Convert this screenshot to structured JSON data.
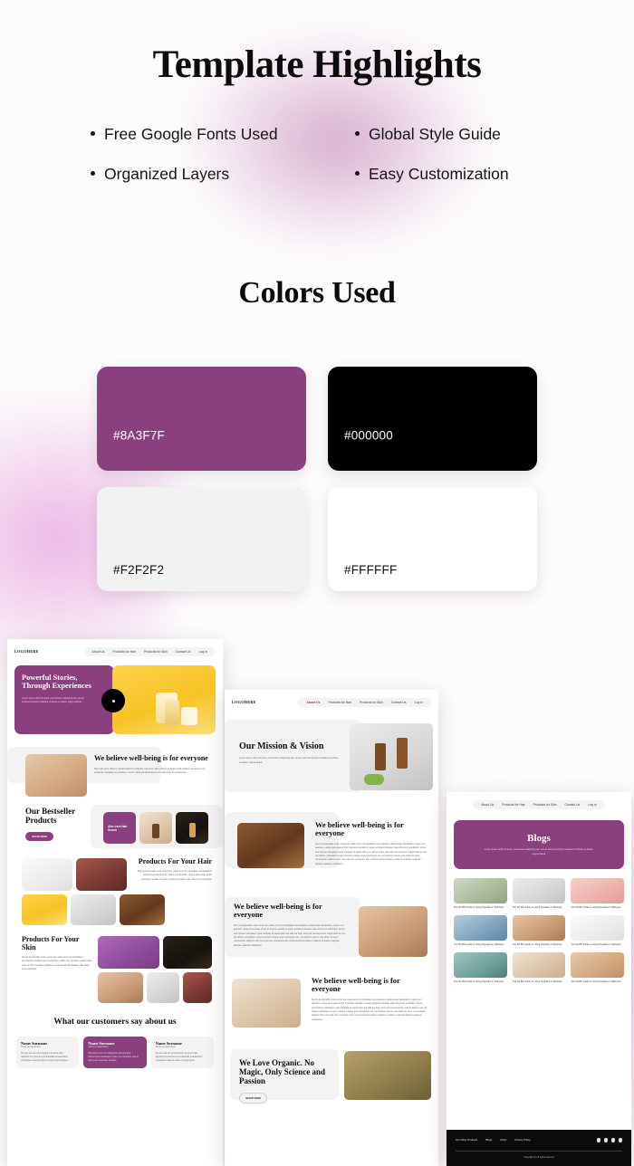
{
  "page": {
    "main_title": "Template Highlights",
    "colors_title": "Colors Used"
  },
  "highlights": [
    {
      "label": "Free Google Fonts Used"
    },
    {
      "label": "Global Style Guide"
    },
    {
      "label": "Organized Layers"
    },
    {
      "label": "Easy Customization"
    }
  ],
  "swatches": [
    {
      "hex": "#8A3F7F",
      "label": "#8A3F7F",
      "text_color": "#FFFFFF",
      "label_pos": "mid",
      "border": false
    },
    {
      "hex": "#000000",
      "label": "#000000",
      "text_color": "#FFFFFF",
      "label_pos": "mid",
      "border": false
    },
    {
      "hex": "#F2F2F2",
      "label": "#F2F2F2",
      "text_color": "#111111",
      "label_pos": "low",
      "border": false
    },
    {
      "hex": "#FFFFFF",
      "label": "#FFFFFF",
      "text_color": "#111111",
      "label_pos": "low",
      "border": true
    }
  ],
  "mockups": {
    "nav": {
      "logo": "LOGOHERE",
      "items": [
        "About Us",
        "Products for Hair",
        "Products for Skin",
        "Contact Us",
        "Log In"
      ]
    },
    "home": {
      "hero_title": "Powerful Stories, Through Experiences",
      "hero_body": "Lorem ipsum dolor sit amet, consectetur adipiscing elit, sed do eiusmod tempor incididunt ut labore et dolore magna aliqua.",
      "believe_title": "We believe well-being is for everyone",
      "believe_body": "Duis aute irure dolor in reprehenderit in voluptate velit esse cillum dolore eu fugiat nulla pariatur. Excepteur sint occaecat cupidatat non proident, sunt in culpa qui officia deserunt mollit anim id est laborum.",
      "bestseller_title": "Our Bestseller Products",
      "shop_button": "SHOP NOW",
      "product_card_label": "Aloe vera Hair Serum",
      "hair_title": "Products For Your Hair",
      "hair_body": "Sed ut perspiciatis unde omnis iste natus error sit voluptatem accusantium doloremque laudantium, totam rem aperiam, eaque ipsa quae ab illo inventore veritatis et quasi architecto beatae vitae dicta sunt explicabo.",
      "skin_title": "Products For Your Skin",
      "skin_body": "Sed ut perspiciatis unde omnis iste natus error sit voluptatem accusantium doloremque laudantium, totam rem aperiam, eaque ipsa quae ab illo inventore veritatis et quasi architecto beatae vitae dicta sunt explicabo.",
      "testimonials_title": "What our customers say about us",
      "testimonials": [
        {
          "name": "Name Surname",
          "role": "Works at organization",
          "body": "We are wat our accusantium sit amet odio dignissimos ducimus qui blanditiis praesentium voluptatum deleniti atque corrupti quos dolores."
        },
        {
          "name": "Name Surname",
          "role": "Works at organization",
          "body": "We natus error sit voluptatem accusantium doloremque laudantium totam rem aperiam eaque ipsa quae inventore veritatis."
        },
        {
          "name": "Name Surname",
          "role": "Works at organization",
          "body": "We are wat our accusantium sit amet odio dignissimos ducimus qui blanditiis praesentium voluptatum deleniti atque corrupti quos."
        }
      ]
    },
    "about": {
      "active_nav": "About Us",
      "mission_title": "Our Mission & Vision",
      "mission_body": "Lorem ipsum dolor sit amet, consectetur adipiscing elit, sed do eiusmod tempor incididunt ut labore et dolore magna aliqua.",
      "believe_title": "We believe well-being is for everyone",
      "believe_body": "Sed ut perspiciatis unde omnis iste natus error sit voluptatem accusantium doloremque laudantium, totam rem aperiam, eaque ipsa quae ab illo inventore veritatis et quasi architecto beatae vitae dicta sunt explicabo. Nemo enim ipsam voluptatem quia voluptas sit aspernatur aut odit aut fugit, sed quia consequuntur magni dolores eos qui ratione voluptatem sequi nesciunt. Neque porro quisquam est, qui dolorem ipsum quia dolor sit amet, consectetur, adipisci velit, sed quia non numquam eius modi tempora incidunt ut labore et dolore magnam aliquam quaerat voluptatem.",
      "organic_title": "We Love Organic. No Magic, Only Science and Passion"
    },
    "blogs": {
      "banner_title": "Blogs",
      "banner_body": "Lorem ipsum dolor sit amet, consectetur adipiscing elit, sed do eiusmod tempor incididunt ut labore et dolore magna aliqua.",
      "card_title": "The No BS Guide to Using Peptides in Skincare",
      "footer": {
        "links": [
          "Our Other Products",
          "Blogs",
          "FAQs",
          "Privacy Policy"
        ],
        "socials": [
          "facebook-icon",
          "instagram-icon",
          "twitter-icon",
          "linkedin-icon"
        ],
        "copyright": "Copyright (c) All rights reserved"
      }
    }
  }
}
